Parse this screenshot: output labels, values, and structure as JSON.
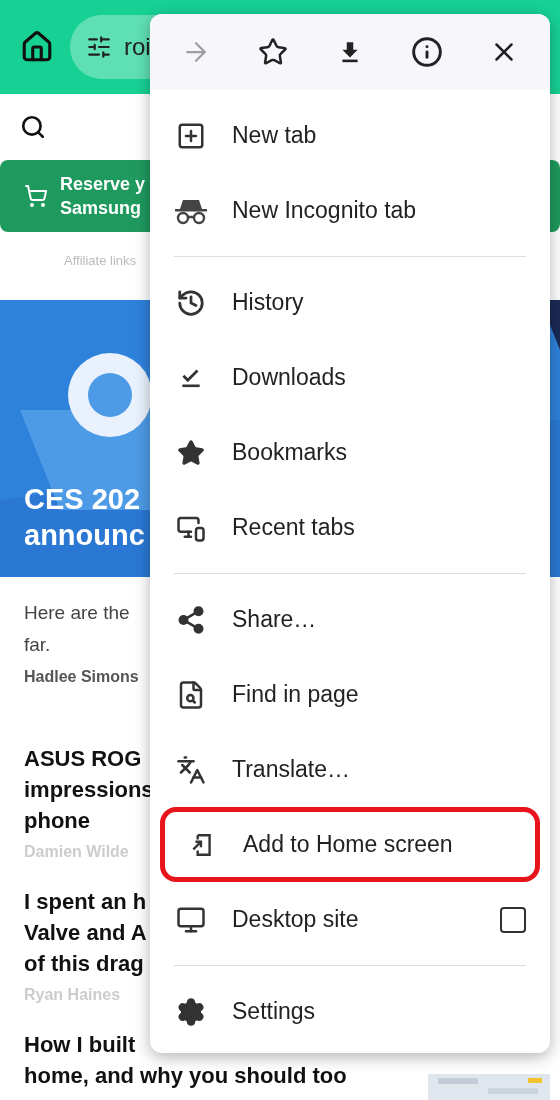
{
  "address_bar": {
    "url": "roi"
  },
  "banner": {
    "lines": [
      "Reserve y",
      "Samsung"
    ]
  },
  "affiliate_note": "Affiliate links",
  "hero": {
    "title_lines": [
      "CES 202",
      "announc"
    ]
  },
  "lead": {
    "lines": [
      "Here are the",
      "far."
    ],
    "author": "Hadlee Simons"
  },
  "articles": [
    {
      "title_lines": [
        "ASUS ROG",
        "impressions",
        "phone"
      ],
      "author": "Damien Wilde"
    },
    {
      "title_lines": [
        "I spent an h",
        "Valve and A",
        "of this drag"
      ],
      "author": "Ryan Haines"
    },
    {
      "title_lines": [
        "How I built",
        "home, and why you should too"
      ]
    }
  ],
  "menu": {
    "toolbar": [
      {
        "disabled": true
      },
      {
        "disabled": false
      },
      {
        "disabled": false
      },
      {
        "disabled": false
      },
      {
        "disabled": false
      }
    ],
    "groups": [
      [
        {
          "kind": "item",
          "label": "New tab",
          "highlighted": false
        },
        {
          "kind": "item",
          "label": "New Incognito tab",
          "highlighted": false
        }
      ],
      [
        {
          "kind": "item",
          "label": "History",
          "highlighted": false
        },
        {
          "kind": "item",
          "label": "Downloads",
          "highlighted": false
        },
        {
          "kind": "item",
          "label": "Bookmarks",
          "highlighted": false
        },
        {
          "kind": "item",
          "label": "Recent tabs",
          "highlighted": false
        }
      ],
      [
        {
          "kind": "item",
          "label": "Share…",
          "highlighted": false
        },
        {
          "kind": "item",
          "label": "Find in page",
          "highlighted": false
        },
        {
          "kind": "item",
          "label": "Translate…",
          "highlighted": false
        },
        {
          "kind": "item",
          "label": "Add to Home screen",
          "highlighted": true
        },
        {
          "kind": "checkbox",
          "label": "Desktop site",
          "checked": false,
          "highlighted": false
        }
      ],
      [
        {
          "kind": "item",
          "label": "Settings",
          "highlighted": false
        }
      ]
    ]
  }
}
